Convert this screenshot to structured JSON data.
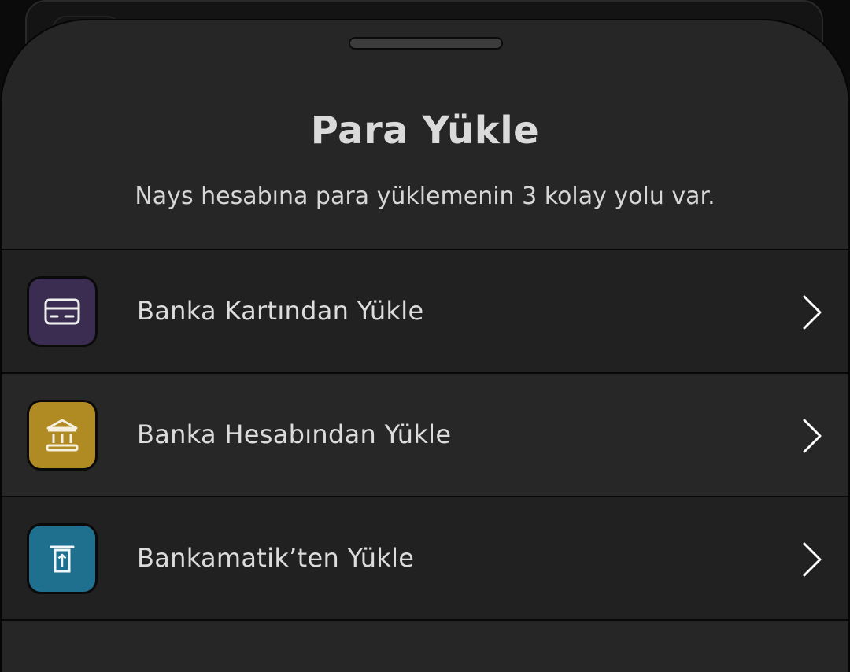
{
  "sheet": {
    "title": "Para Yükle",
    "subtitle": "Nays hesabına para yüklemenin 3 kolay yolu var."
  },
  "options": [
    {
      "label": "Banka Kartından Yükle",
      "icon": "credit-card-icon",
      "color": "#3b2d52"
    },
    {
      "label": "Banka Hesabından Yükle",
      "icon": "bank-icon",
      "color": "#b08a22"
    },
    {
      "label": "Bankamatik’ten Yükle",
      "icon": "atm-icon",
      "color": "#1f6f8e"
    }
  ]
}
